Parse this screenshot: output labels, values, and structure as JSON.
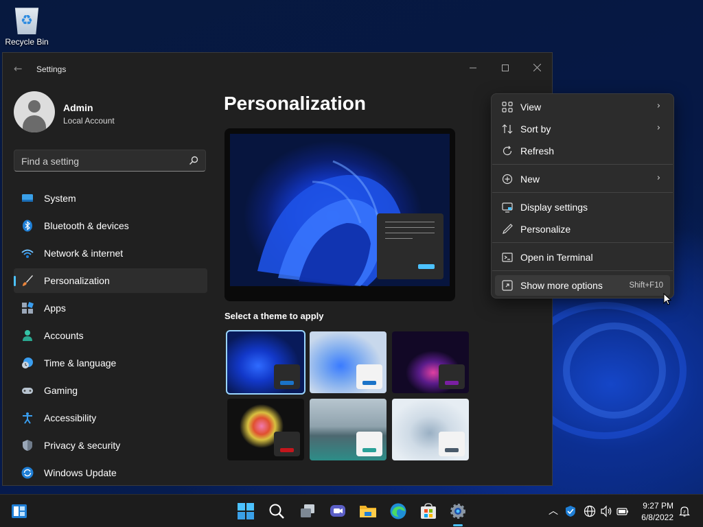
{
  "desktop": {
    "icons": [
      {
        "label": "Recycle Bin",
        "icon": "recycle-bin-icon"
      }
    ]
  },
  "window": {
    "title": "Settings",
    "controls": [
      "minimize",
      "maximize",
      "close"
    ]
  },
  "profile": {
    "name": "Admin",
    "account_type": "Local Account"
  },
  "search": {
    "placeholder": "Find a setting"
  },
  "sidebar": {
    "items": [
      {
        "label": "System",
        "icon": "system-icon",
        "active": false
      },
      {
        "label": "Bluetooth & devices",
        "icon": "bluetooth-icon",
        "active": false
      },
      {
        "label": "Network & internet",
        "icon": "wifi-icon",
        "active": false
      },
      {
        "label": "Personalization",
        "icon": "brush-icon",
        "active": true
      },
      {
        "label": "Apps",
        "icon": "apps-icon",
        "active": false
      },
      {
        "label": "Accounts",
        "icon": "accounts-icon",
        "active": false
      },
      {
        "label": "Time & language",
        "icon": "time-language-icon",
        "active": false
      },
      {
        "label": "Gaming",
        "icon": "gaming-icon",
        "active": false
      },
      {
        "label": "Accessibility",
        "icon": "accessibility-icon",
        "active": false
      },
      {
        "label": "Privacy & security",
        "icon": "shield-icon",
        "active": false
      },
      {
        "label": "Windows Update",
        "icon": "windows-update-icon",
        "active": false
      }
    ]
  },
  "main": {
    "title": "Personalization",
    "themes_heading": "Select a theme to apply",
    "themes": [
      {
        "name": "windows-dark",
        "selected": true,
        "accent": "#1a73c8"
      },
      {
        "name": "windows-light",
        "selected": false,
        "accent": "#1a73c8"
      },
      {
        "name": "glow",
        "selected": false,
        "accent": "#7a1fa2"
      },
      {
        "name": "captured-motion",
        "selected": false,
        "accent": "#c4161c"
      },
      {
        "name": "sunrise",
        "selected": false,
        "accent": "#2aa198"
      },
      {
        "name": "flow",
        "selected": false,
        "accent": "#4a5a6a"
      }
    ]
  },
  "context_menu": {
    "items": [
      {
        "label": "View",
        "icon": "view-grid-icon",
        "submenu": true
      },
      {
        "label": "Sort by",
        "icon": "sort-icon",
        "submenu": true
      },
      {
        "label": "Refresh",
        "icon": "refresh-icon",
        "submenu": false
      },
      {
        "label": "New",
        "icon": "new-plus-icon",
        "submenu": true
      },
      {
        "label": "Display settings",
        "icon": "display-icon",
        "submenu": false
      },
      {
        "label": "Personalize",
        "icon": "pen-icon",
        "submenu": false
      },
      {
        "label": "Open in Terminal",
        "icon": "terminal-icon",
        "submenu": false
      },
      {
        "label": "Show more options",
        "icon": "more-options-icon",
        "submenu": false,
        "shortcut": "Shift+F10",
        "highlighted": true
      }
    ]
  },
  "taskbar": {
    "apps": [
      "start",
      "search",
      "task-view",
      "chat",
      "file-explorer",
      "edge",
      "store",
      "settings"
    ],
    "running": "settings",
    "tray": [
      "chevron-up",
      "defender",
      "network",
      "volume",
      "battery",
      "notifications"
    ],
    "time": "9:27 PM",
    "date": "6/8/2022"
  },
  "colors": {
    "accent": "#4cc2ff",
    "window_bg": "#202020",
    "menu_bg": "#2c2c2c"
  }
}
